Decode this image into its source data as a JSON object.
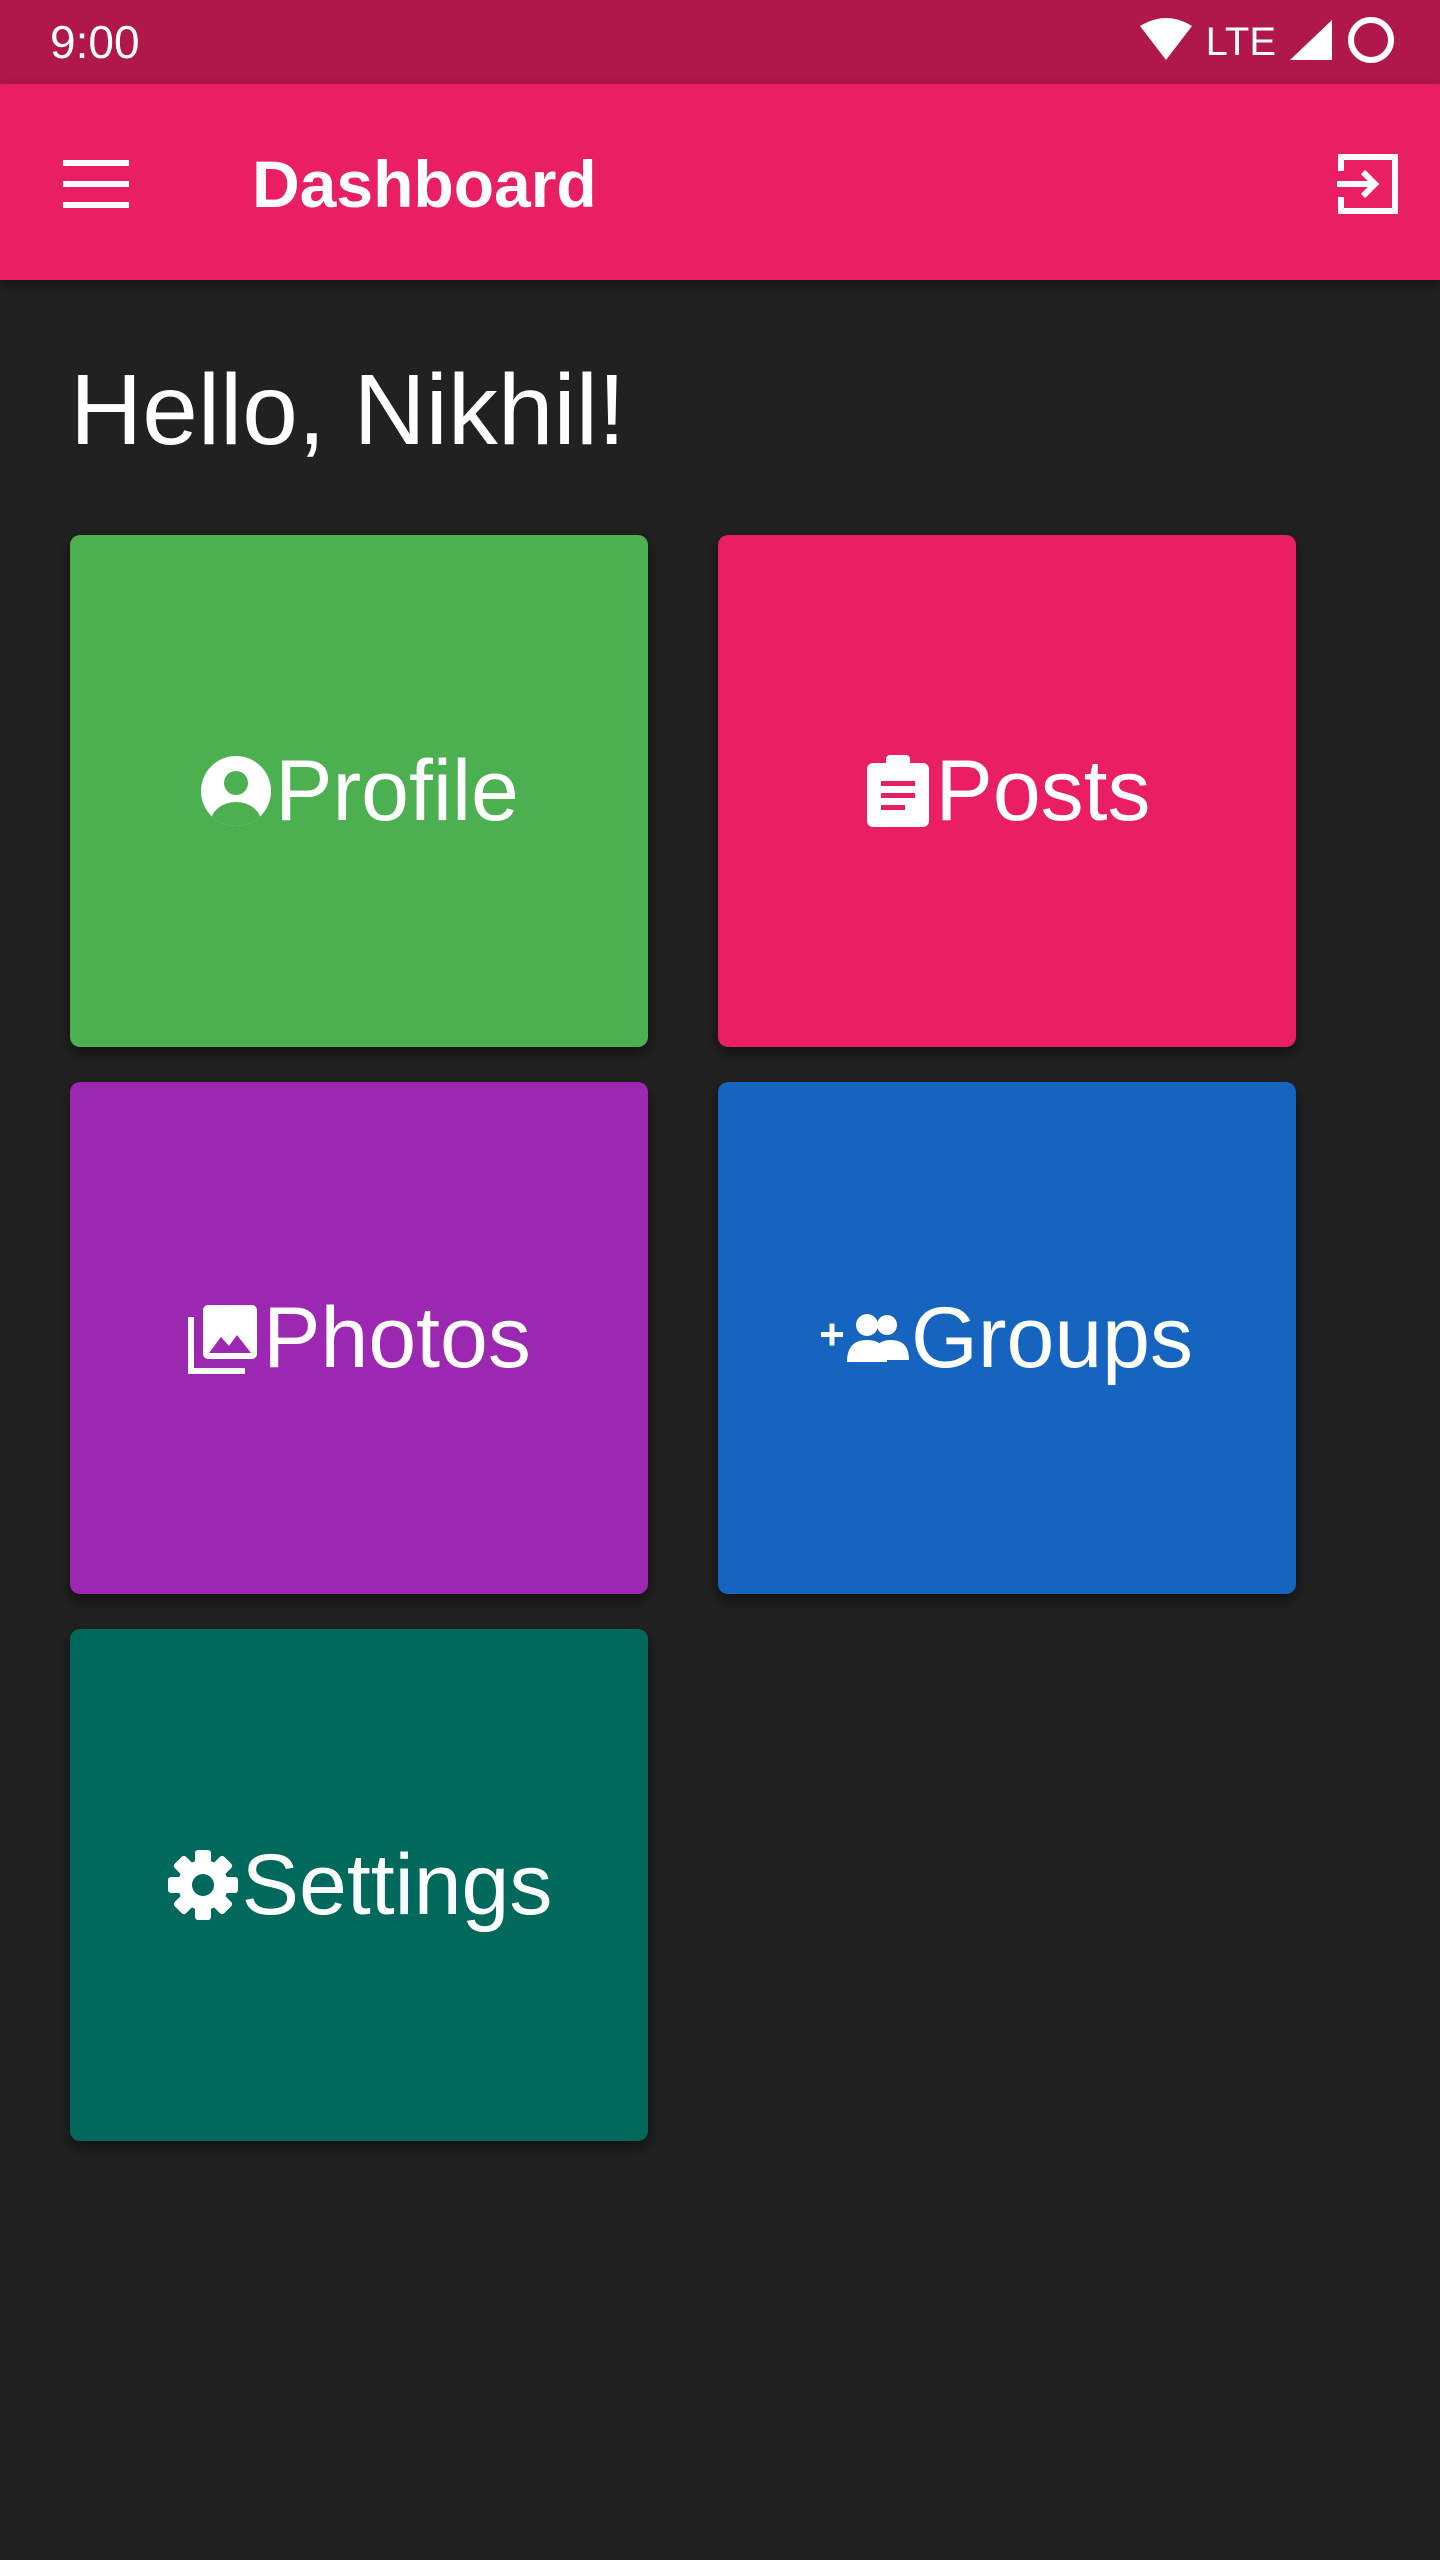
{
  "status_bar": {
    "time": "9:00",
    "network": "LTE",
    "icons": [
      "wifi-icon",
      "cell-signal-icon",
      "circle-icon"
    ],
    "background": "#B0174A"
  },
  "app_bar": {
    "title": "Dashboard",
    "menu_icon": "hamburger-menu-icon",
    "action_icon": "logout-icon",
    "background": "#E91E63"
  },
  "greeting": "Hello, Nikhil!",
  "tiles": [
    {
      "label": "Profile",
      "icon": "account-circle-icon",
      "color": "#4CAF50"
    },
    {
      "label": "Posts",
      "icon": "clipboard-icon",
      "color": "#E91E63"
    },
    {
      "label": "Photos",
      "icon": "photo-library-icon",
      "color": "#9C27B0"
    },
    {
      "label": "Groups",
      "icon": "group-add-icon",
      "color": "#1565C0"
    },
    {
      "label": "Settings",
      "icon": "gear-icon",
      "color": "#00695C"
    }
  ],
  "background": "#212121"
}
